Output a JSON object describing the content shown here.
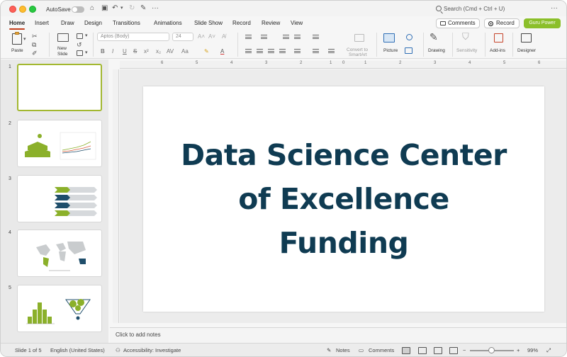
{
  "titlebar": {
    "autosave_label": "AutoSave",
    "search_placeholder": "Search (Cmd + Ctrl + U)"
  },
  "tabs": [
    "Home",
    "Insert",
    "Draw",
    "Design",
    "Transitions",
    "Animations",
    "Slide Show",
    "Record",
    "Review",
    "View"
  ],
  "active_tab": "Home",
  "actions": {
    "comments": "Comments",
    "record": "Record",
    "addin": "Guru Power"
  },
  "ribbon": {
    "paste": "Paste",
    "new_slide_line1": "New",
    "new_slide_line2": "Slide",
    "font_name": "Aptos (Body)",
    "font_size": "24",
    "convert_line1": "Convert to",
    "convert_line2": "SmartArt",
    "picture": "Picture",
    "drawing": "Drawing",
    "sensitivity": "Sensitivity",
    "addins": "Add-ins",
    "designer": "Designer"
  },
  "thumbnails": [
    {
      "num": "1",
      "selected": true
    },
    {
      "num": "2",
      "selected": false
    },
    {
      "num": "3",
      "selected": false
    },
    {
      "num": "4",
      "selected": false
    },
    {
      "num": "5",
      "selected": false
    }
  ],
  "ruler_labels": [
    "6",
    "5",
    "4",
    "3",
    "2",
    "1",
    "0",
    "1",
    "2",
    "3",
    "4",
    "5",
    "6"
  ],
  "slide": {
    "title_line1": "Data Science Center",
    "title_line2": "of Excellence",
    "title_line3": "Funding",
    "title_color": "#0f3b52"
  },
  "notes_placeholder": "Click to add notes",
  "status": {
    "slide_of": "Slide 1 of 5",
    "language": "English (United States)",
    "accessibility": "Accessibility: Investigate",
    "notes": "Notes",
    "comments": "Comments",
    "zoom": "99%"
  },
  "colors": {
    "accent_tab": "#c43e1c",
    "guru_button": "#8bbf2a",
    "thumb_selected_border": "#a3b830",
    "thumb_green": "#8bb02a",
    "thumb_navy": "#1f4e6b"
  }
}
